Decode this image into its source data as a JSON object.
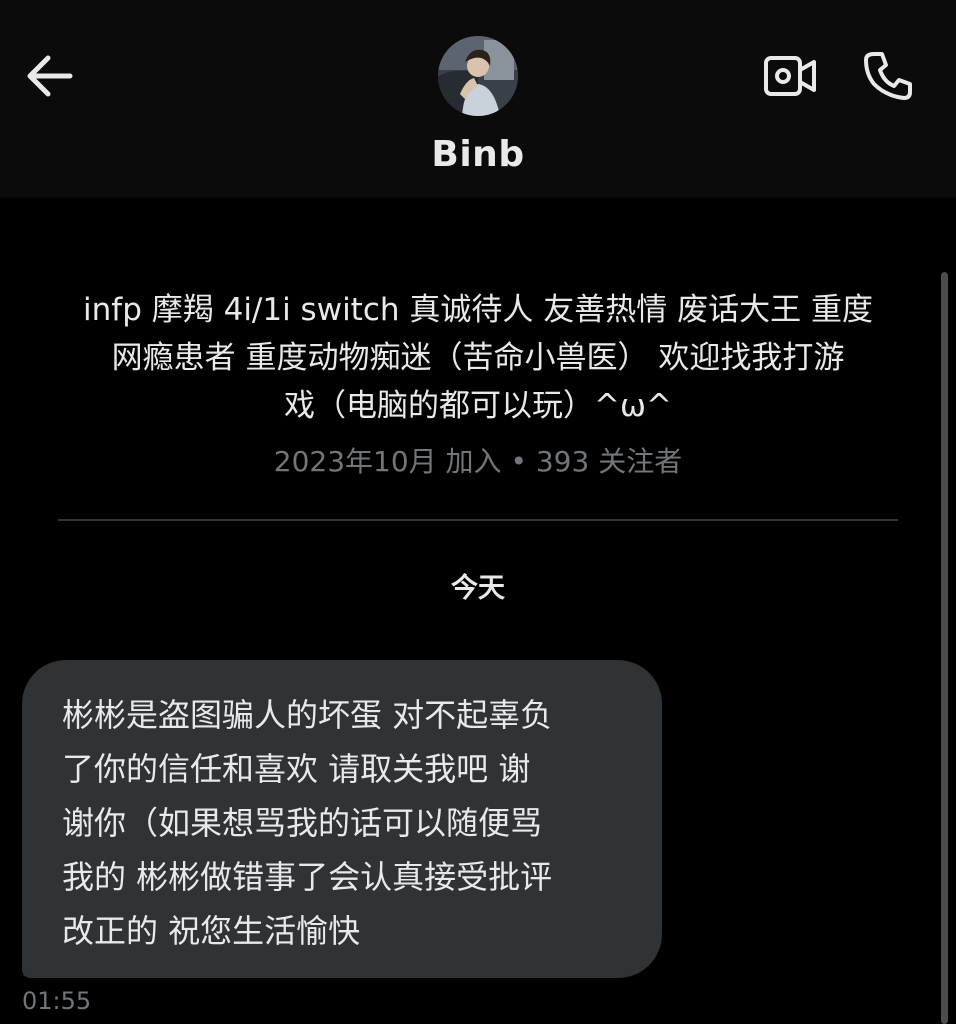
{
  "header": {
    "back_icon": "arrow-left-icon",
    "contact_name": "Binb",
    "video_icon": "video-camera-icon",
    "call_icon": "phone-icon"
  },
  "profile": {
    "bio_lines": [
      "infp 摩羯 4i/1i switch 真诚待人 友善热情 废话大王 重度",
      "网瘾患者 重度动物痴迷（苦命小兽医） 欢迎找我打游",
      "戏（电脑的都可以玩）^ω^"
    ],
    "meta": "2023年10月 加入 • 393 关注者"
  },
  "conversation": {
    "date_separator": "今天",
    "messages": [
      {
        "lines": [
          "彬彬是盗图骗人的坏蛋 对不起辜负",
          "了你的信任和喜欢 请取关我吧 谢",
          "谢你（如果想骂我的话可以随便骂",
          "我的 彬彬做错事了会认真接受批评",
          "改正的 祝您生活愉快"
        ],
        "time": "01:55"
      }
    ]
  },
  "colors": {
    "background": "#000000",
    "header_background": "#0b0b0b",
    "bubble": "#2f3336",
    "text": "#e7e9ea",
    "muted": "#71767b"
  }
}
